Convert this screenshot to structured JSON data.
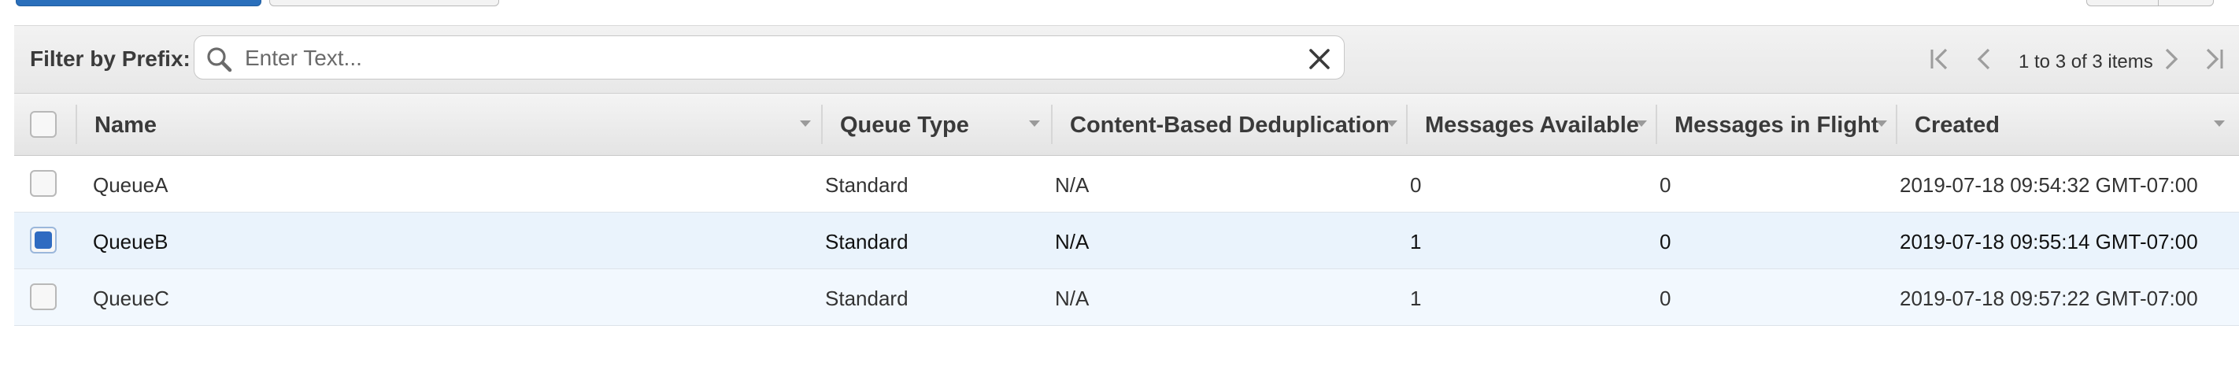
{
  "filter": {
    "label": "Filter by Prefix:",
    "placeholder": "Enter Text...",
    "value": ""
  },
  "pager": {
    "text": "1 to 3 of 3 items"
  },
  "table": {
    "columns": [
      "Name",
      "Queue Type",
      "Content-Based Deduplication",
      "Messages Available",
      "Messages in Flight",
      "Created"
    ],
    "rows": [
      {
        "selected": false,
        "name": "QueueA",
        "queue_type": "Standard",
        "dedup": "N/A",
        "available": "0",
        "in_flight": "0",
        "created": "2019-07-18 09:54:32 GMT-07:00"
      },
      {
        "selected": true,
        "name": "QueueB",
        "queue_type": "Standard",
        "dedup": "N/A",
        "available": "1",
        "in_flight": "0",
        "created": "2019-07-18 09:55:14 GMT-07:00"
      },
      {
        "selected": false,
        "name": "QueueC",
        "queue_type": "Standard",
        "dedup": "N/A",
        "available": "1",
        "in_flight": "0",
        "created": "2019-07-18 09:57:22 GMT-07:00"
      }
    ]
  },
  "colors": {
    "accent": "#2f6bc1",
    "selected_row": "#eaf3fc"
  }
}
